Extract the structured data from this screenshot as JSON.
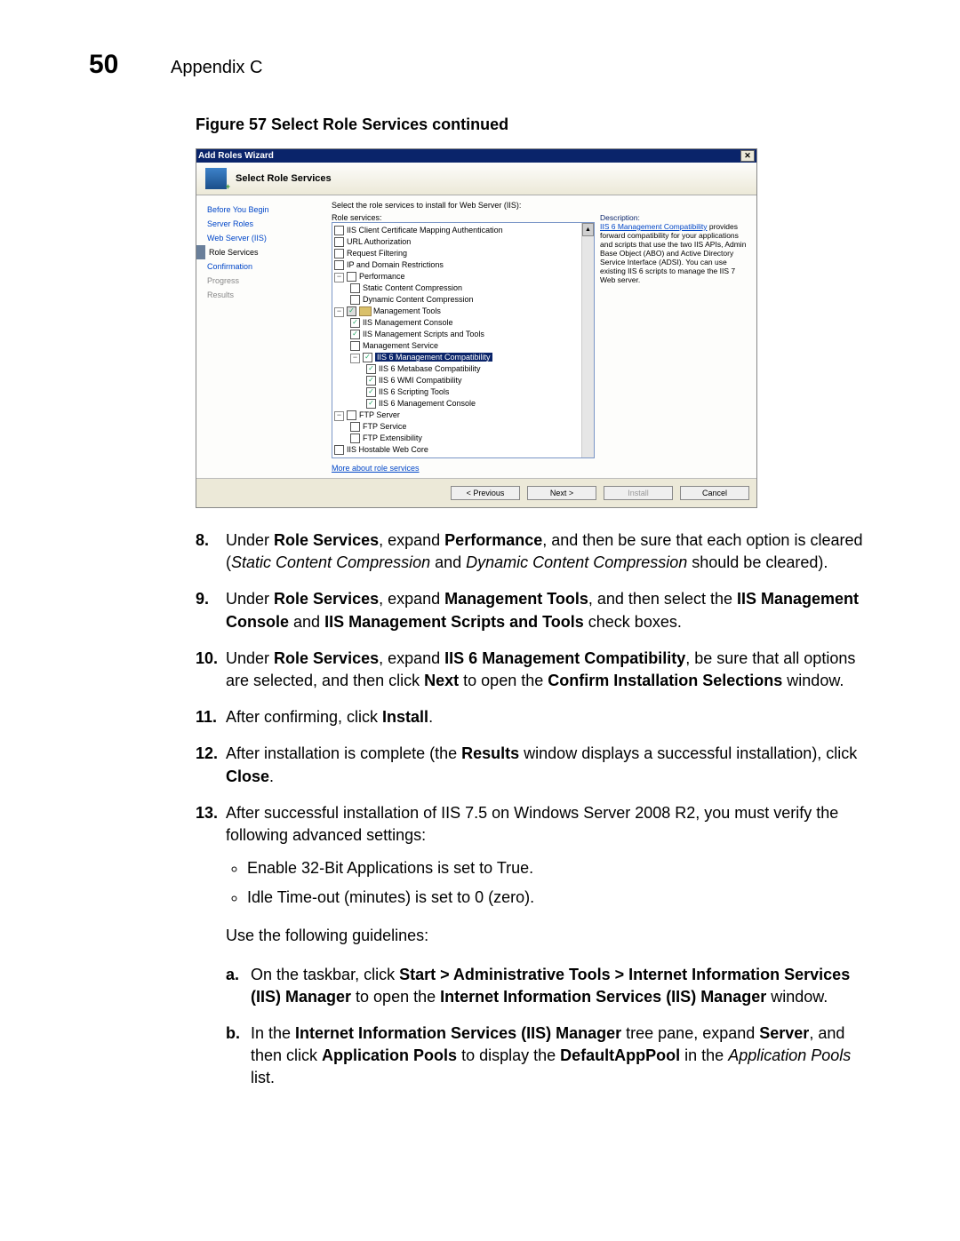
{
  "header": {
    "page_number": "50",
    "appendix": "Appendix C"
  },
  "figure_caption": "Figure 57    Select Role Services continued",
  "wizard": {
    "titlebar": "Add Roles Wizard",
    "header_title": "Select Role Services",
    "steps": {
      "before": "Before You Begin",
      "server_roles": "Server Roles",
      "web_server": "Web Server (IIS)",
      "role_services": "Role Services",
      "confirmation": "Confirmation",
      "progress": "Progress",
      "results": "Results"
    },
    "instruction": "Select the role services to install for Web Server (IIS):",
    "list_label": "Role services:",
    "desc_label": "Description:",
    "desc_link": "IIS 6 Management Compatibility",
    "desc_text": "provides forward compatibility for your applications and scripts that use the two IIS APIs, Admin Base Object (ABO) and Active Directory Service Interface (ADSI). You can use existing IIS 6 scripts to manage the IIS 7 Web server.",
    "tree": {
      "iis_client_cert": "IIS Client Certificate Mapping Authentication",
      "url_auth": "URL Authorization",
      "req_filter": "Request Filtering",
      "ip_domain": "IP and Domain Restrictions",
      "performance": "Performance",
      "scc": "Static Content Compression",
      "dcc": "Dynamic Content Compression",
      "mgmt_tools": "Management Tools",
      "mgmt_console": "IIS Management Console",
      "mgmt_scripts": "IIS Management Scripts and Tools",
      "mgmt_service": "Management Service",
      "iis6_compat": "IIS 6 Management Compatibility",
      "iis6_metabase": "IIS 6 Metabase Compatibility",
      "iis6_wmi": "IIS 6 WMI Compatibility",
      "iis6_script": "IIS 6 Scripting Tools",
      "iis6_console": "IIS 6 Management Console",
      "ftp": "FTP Server",
      "ftp_service": "FTP Service",
      "ftp_ext": "FTP Extensibility",
      "hostable": "IIS Hostable Web Core"
    },
    "more_link": "More about role services",
    "buttons": {
      "previous": "< Previous",
      "next": "Next >",
      "install": "Install",
      "cancel": "Cancel"
    }
  },
  "steps": {
    "8": {
      "pre": "Under ",
      "b1": "Role Services",
      "mid1": ", expand ",
      "b2": "Performance",
      "mid2": ", and then be sure that each option is cleared (",
      "i1": "Static Content Compression",
      "mid3": " and ",
      "i2": "Dynamic Content Compression",
      "end": " should be cleared)."
    },
    "9": {
      "pre": "Under ",
      "b1": "Role Services",
      "mid1": ", expand ",
      "b2": "Management Tools",
      "mid2": ", and then select the ",
      "b3": "IIS Management Console",
      "mid3": " and ",
      "b4": "IIS Management Scripts and Tools",
      "end": " check boxes."
    },
    "10": {
      "pre": "Under ",
      "b1": "Role Services",
      "mid1": ", expand ",
      "b2": "IIS 6 Management Compatibility",
      "mid2": ", be sure that all options are selected, and then click ",
      "b3": "Next",
      "mid3": " to open the ",
      "b4": "Confirm Installation Selections",
      "end": " window."
    },
    "11": {
      "pre": "After confirming, click ",
      "b1": "Install",
      "end": "."
    },
    "12": {
      "pre": "After installation is complete (the ",
      "b1": "Results",
      "mid1": " window displays a successful installation), click ",
      "b2": "Close",
      "end": "."
    },
    "13": {
      "intro": "After successful installation of IIS 7.5 on Windows Server 2008 R2, you must verify the following advanced settings:",
      "bullet1": "Enable 32-Bit Applications is set to True.",
      "bullet2": "Idle Time-out (minutes) is set to 0 (zero).",
      "guidelines": "Use the following guidelines:",
      "a": {
        "pre": "On the taskbar, click ",
        "b1": "Start > Administrative Tools > Internet Information Services (IIS) Manager",
        "mid1": " to open the ",
        "b2": "Internet Information Services (IIS) Manager",
        "end": " window."
      },
      "b": {
        "pre": "In the ",
        "b1": "Internet Information Services (IIS) Manager",
        "mid1": " tree pane, expand ",
        "b2": "Server",
        "mid2": ", and then click ",
        "b3": "Application Pools",
        "mid3": " to display the ",
        "b4": "DefaultAppPool",
        "mid4": " in the ",
        "i1": "Application Pools",
        "end": " list."
      }
    }
  }
}
